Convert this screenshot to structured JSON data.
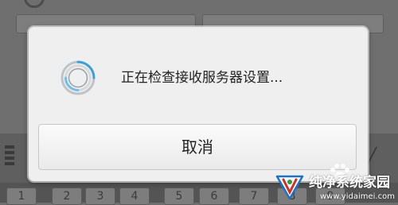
{
  "background": {
    "keyboard_keys": [
      "1",
      "2",
      "3",
      "4",
      "5",
      "6",
      "7",
      "8",
      "9"
    ]
  },
  "dialog": {
    "spinner_icon": "loading-spinner",
    "message": "正在检查接收服务器设置...",
    "cancel_label": "取消"
  },
  "watermark": {
    "text": "纯净系统家园",
    "url": "www.yidaimei.com",
    "accent": "#1a73c7"
  }
}
